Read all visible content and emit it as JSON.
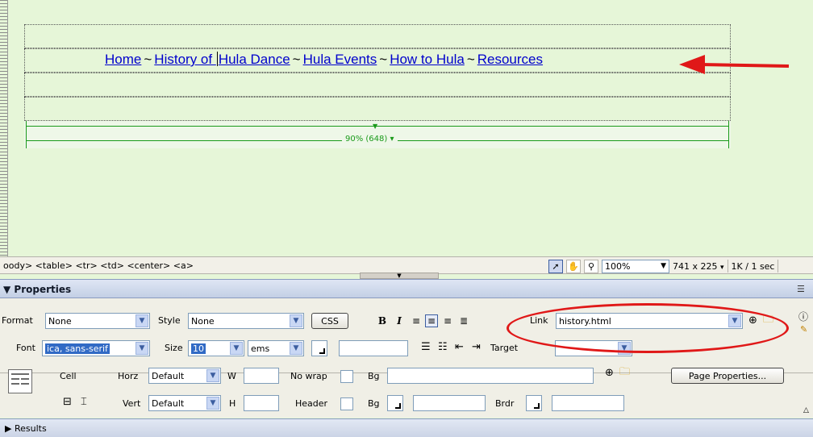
{
  "nav": {
    "home": "Home",
    "history": "History of Hula Dance",
    "events": "Hula Events",
    "howto": "How to Hula",
    "resources": "Resources",
    "separator": "~"
  },
  "table_width_label": "90% (648)",
  "statusbar": {
    "tag_selector": "oody> <table> <tr> <td> <center> <a>",
    "zoom": "100%",
    "window_size": "741 x 225",
    "download": "1K / 1 sec"
  },
  "properties": {
    "title": "Properties",
    "format_label": "Format",
    "format_value": "None",
    "style_label": "Style",
    "style_value": "None",
    "css_button": "CSS",
    "bold": "B",
    "italic": "I",
    "link_label": "Link",
    "link_value": "history.html",
    "font_label": "Font",
    "font_value": "ica, sans-serif",
    "size_label": "Size",
    "size_value": "10",
    "size_unit": "ems",
    "target_label": "Target",
    "cell_label": "Cell",
    "horz_label": "Horz",
    "horz_value": "Default",
    "w_label": "W",
    "nowrap_label": "No wrap",
    "bg_label": "Bg",
    "page_properties_button": "Page Properties...",
    "vert_label": "Vert",
    "vert_value": "Default",
    "h_label": "H",
    "header_label": "Header",
    "bg2_label": "Bg",
    "brdr_label": "Brdr"
  },
  "results_label": "Results",
  "colors": {
    "annotation": "#e01818",
    "link": "#0000cc",
    "width_bar": "#1a9a1a",
    "design_bg": "#e6f6d8"
  }
}
